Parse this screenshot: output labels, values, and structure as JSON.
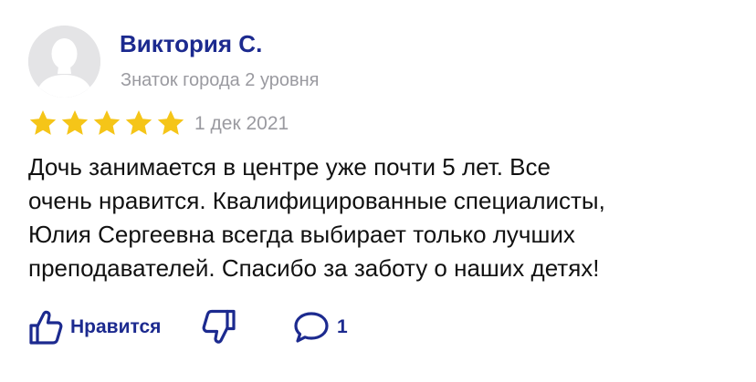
{
  "author": {
    "name": "Виктория С.",
    "level": "Знаток города 2 уровня",
    "avatar_icon": "default-user-silhouette"
  },
  "rating": {
    "stars": 5,
    "max": 5,
    "star_color": "#f5c518"
  },
  "review": {
    "date": "1 дек 2021",
    "text_lines": [
      "Дочь занимается в центре уже почти 5 лет. Все",
      "очень нравится. Квалифицированные специалисты,",
      "Юлия Сергеевна всегда выбирает только лучших",
      "преподавателей. Спасибо за заботу о наших детях!"
    ]
  },
  "actions": {
    "like_label": "Нравится",
    "like_icon": "thumbs-up-icon",
    "dislike_icon": "thumbs-down-icon",
    "comment_icon": "comment-bubble-icon",
    "comment_count": "1"
  },
  "colors": {
    "accent": "#1c2a8f",
    "muted_text": "#9a9aa0",
    "body_text": "#111111",
    "avatar_bg": "#e4e4e6"
  }
}
